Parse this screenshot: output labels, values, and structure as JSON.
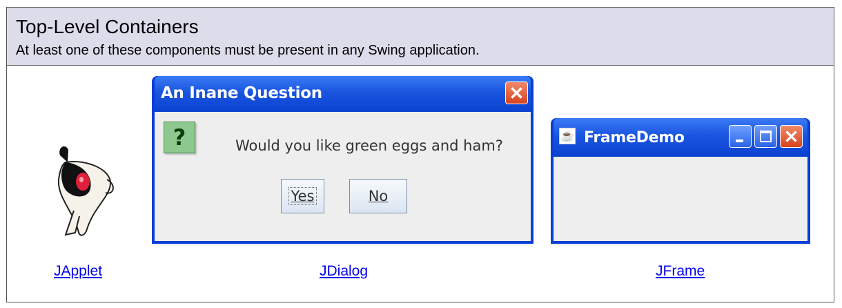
{
  "header": {
    "title": "Top-Level Containers",
    "subtitle": "At least one of these components must be present in any Swing application."
  },
  "components": {
    "applet_link": "JApplet",
    "dialog_link": "JDialog",
    "frame_link": "JFrame"
  },
  "dialog": {
    "title": "An Inane Question",
    "message": "Would you like green eggs and ham?",
    "icon_glyph": "?",
    "yes_label": "Yes",
    "no_label": "No",
    "close_glyph": "✕"
  },
  "frame": {
    "title": "FrameDemo",
    "close_glyph": "✕"
  },
  "colors": {
    "header_bg": "#dcdcea",
    "link": "#0000ee",
    "titlebar_blue": "#0a3fd6",
    "close_red": "#d8431c"
  }
}
